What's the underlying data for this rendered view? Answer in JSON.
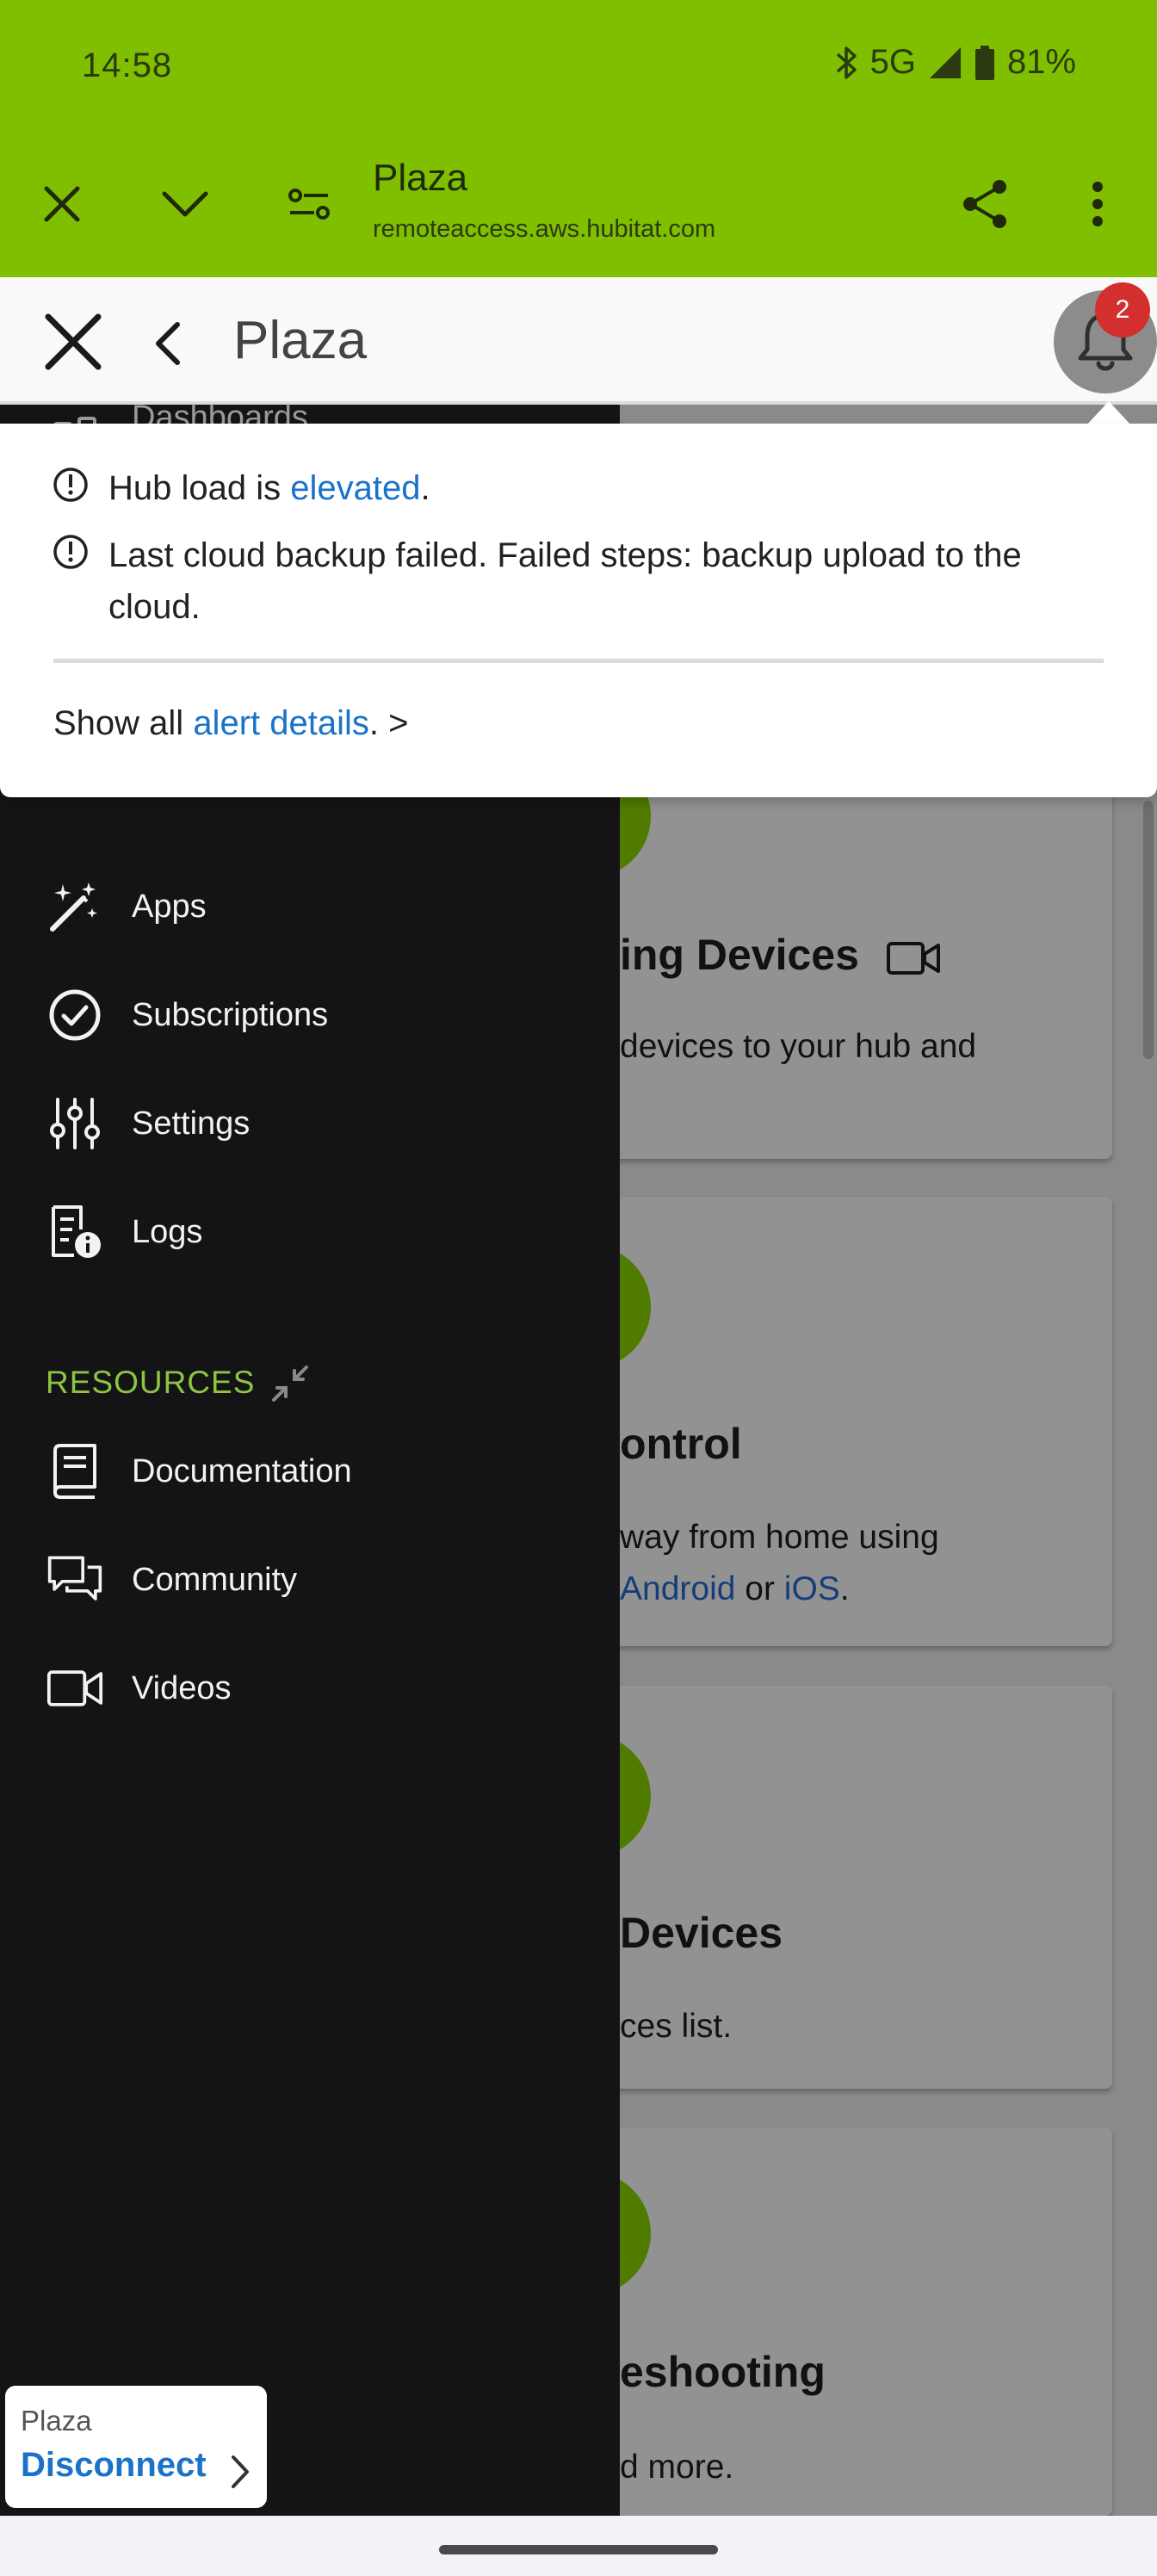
{
  "status_bar": {
    "time": "14:58",
    "network": "5G",
    "battery": "81%"
  },
  "browser": {
    "title": "Plaza",
    "url": "remoteaccess.aws.hubitat.com"
  },
  "header": {
    "title": "Plaza",
    "notification_count": "2"
  },
  "alerts": {
    "items": [
      {
        "before": "Hub load is ",
        "link": "elevated",
        "after": "."
      },
      {
        "text": "Last cloud backup failed. Failed steps: backup upload to the cloud."
      }
    ],
    "show_all_before": "Show all ",
    "show_all_link": "alert details",
    "show_all_after": ". >"
  },
  "drawer": {
    "partial_item": "Dashboards",
    "items": [
      {
        "label": "Apps",
        "icon": "magic-wand-icon"
      },
      {
        "label": "Subscriptions",
        "icon": "check-circle-icon"
      },
      {
        "label": "Settings",
        "icon": "sliders-icon"
      },
      {
        "label": "Logs",
        "icon": "log-document-icon"
      }
    ],
    "resources_heading": "RESOURCES",
    "resources": [
      {
        "label": "Documentation",
        "icon": "book-icon"
      },
      {
        "label": "Community",
        "icon": "chat-bubbles-icon"
      },
      {
        "label": "Videos",
        "icon": "video-camera-icon"
      }
    ]
  },
  "background_cards": [
    {
      "title": "ing Devices",
      "lines": [
        "devices to your hub and"
      ]
    },
    {
      "title": "ontrol",
      "line1": "way from home using",
      "line2_link1": "Android",
      "line2_mid": " or ",
      "line2_link2": "iOS",
      "line2_end": "."
    },
    {
      "title": "Devices",
      "lines": [
        "ces list."
      ]
    },
    {
      "title": "eshooting",
      "lines": [
        "d more."
      ]
    }
  ],
  "connection": {
    "hub_name": "Plaza",
    "action": "Disconnect"
  },
  "colors": {
    "brand_green": "#7fbf00",
    "drawer_bg": "#141416",
    "link_blue": "#1a73c8",
    "badge_red": "#d32f2f",
    "resources_green": "#8cc63f"
  }
}
